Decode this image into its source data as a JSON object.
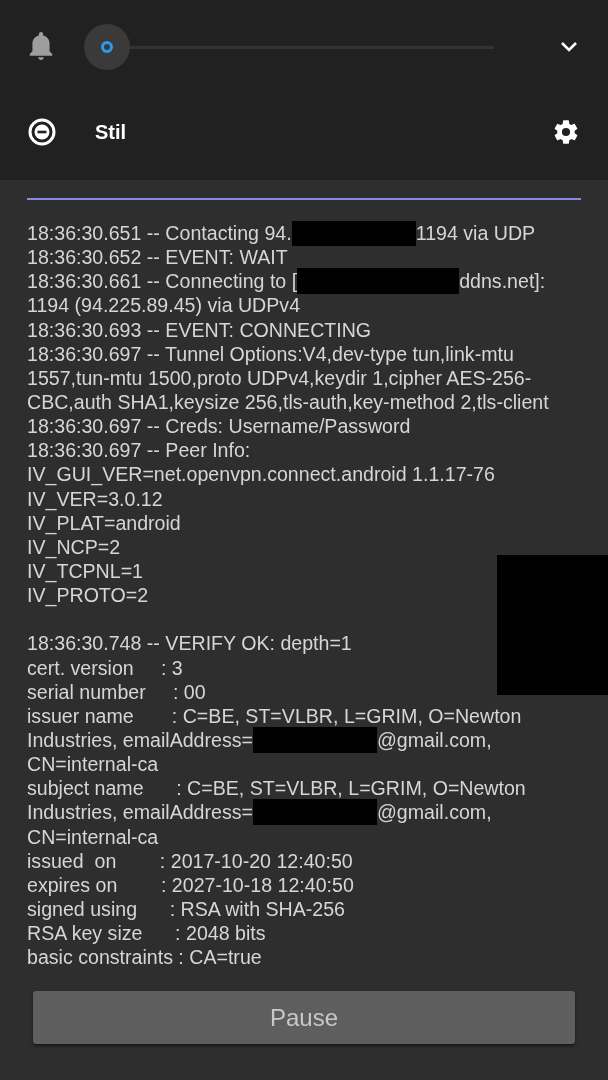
{
  "profile": {
    "label": "Stil"
  },
  "progress_line": {
    "level": 1
  },
  "log": [
    {
      "parts": [
        {
          "kind": "text",
          "text": "18:36:30.651 -- Contacting 94."
        },
        {
          "kind": "redaction"
        },
        {
          "kind": "text",
          "text": "1194 via UDP"
        }
      ]
    },
    {
      "parts": [
        {
          "kind": "text",
          "text": "18:36:30.652 -- EVENT: WAIT"
        }
      ]
    },
    {
      "parts": [
        {
          "kind": "text",
          "text": "18:36:30.661 -- Connecting to ["
        },
        {
          "kind": "wideredaction"
        },
        {
          "kind": "text",
          "text": "ddns.net]:"
        }
      ]
    },
    {
      "parts": [
        {
          "kind": "text",
          "text": "1194 (94.225.89.45) via UDPv4"
        }
      ]
    },
    {
      "parts": [
        {
          "kind": "text",
          "text": "18:36:30.693 -- EVENT: CONNECTING"
        }
      ]
    },
    {
      "parts": [
        {
          "kind": "text",
          "text": "18:36:30.697 -- Tunnel Options:V4,dev-type tun,link-mtu"
        }
      ]
    },
    {
      "parts": [
        {
          "kind": "text",
          "text": "1557,tun-mtu 1500,proto UDPv4,keydir 1,cipher AES-256-"
        }
      ]
    },
    {
      "parts": [
        {
          "kind": "text",
          "text": "CBC,auth SHA1,keysize 256,tls-auth,key-method 2,tls-client"
        }
      ]
    },
    {
      "parts": [
        {
          "kind": "text",
          "text": "18:36:30.697 -- Creds: Username/Password"
        }
      ]
    },
    {
      "parts": [
        {
          "kind": "text",
          "text": "18:36:30.697 -- Peer Info:"
        }
      ]
    },
    {
      "parts": [
        {
          "kind": "text",
          "text": "IV_GUI_VER=net.openvpn.connect.android 1.1.17-76"
        }
      ]
    },
    {
      "parts": [
        {
          "kind": "text",
          "text": "IV_VER=3.0.12"
        }
      ]
    },
    {
      "parts": [
        {
          "kind": "text",
          "text": "IV_PLAT=android"
        }
      ]
    },
    {
      "parts": [
        {
          "kind": "text",
          "text": "IV_NCP=2"
        }
      ]
    },
    {
      "parts": [
        {
          "kind": "text",
          "text": "IV_TCPNL=1"
        }
      ]
    },
    {
      "parts": [
        {
          "kind": "text",
          "text": "IV_PROTO=2"
        }
      ]
    },
    {
      "gap_before": true,
      "parts": [
        {
          "kind": "text",
          "text": "18:36:30.748 -- VERIFY OK: depth=1"
        }
      ]
    },
    {
      "parts": [
        {
          "kind": "text",
          "text": "cert. version     : 3"
        }
      ]
    },
    {
      "parts": [
        {
          "kind": "text",
          "text": "serial number     : 00"
        }
      ]
    },
    {
      "parts": [
        {
          "kind": "text",
          "text": "issuer name       : C=BE, ST=VLBR, L=GRIM, O=Newton"
        }
      ]
    },
    {
      "parts": [
        {
          "kind": "text",
          "text": "Industries, emailAddress="
        },
        {
          "kind": "redaction"
        },
        {
          "kind": "text",
          "text": "@gmail.com,"
        }
      ]
    },
    {
      "parts": [
        {
          "kind": "text",
          "text": "CN=internal-ca"
        }
      ]
    },
    {
      "parts": [
        {
          "kind": "text",
          "text": "subject name      : C=BE, ST=VLBR, L=GRIM, O=Newton"
        }
      ]
    },
    {
      "parts": [
        {
          "kind": "text",
          "text": "Industries, emailAddress="
        },
        {
          "kind": "redaction"
        },
        {
          "kind": "text",
          "text": "@gmail.com,"
        }
      ]
    },
    {
      "parts": [
        {
          "kind": "text",
          "text": "CN=internal-ca"
        }
      ]
    },
    {
      "parts": [
        {
          "kind": "text",
          "text": "issued  on        : 2017-10-20 12:40:50"
        }
      ]
    },
    {
      "parts": [
        {
          "kind": "text",
          "text": "expires on        : 2027-10-18 12:40:50"
        }
      ]
    },
    {
      "parts": [
        {
          "kind": "text",
          "text": "signed using      : RSA with SHA-256"
        }
      ]
    },
    {
      "parts": [
        {
          "kind": "text",
          "text": "RSA key size      : 2048 bits"
        }
      ]
    },
    {
      "parts": [
        {
          "kind": "text",
          "text": "basic constraints : CA=true"
        }
      ]
    }
  ],
  "corner_redaction": true,
  "pause_button": {
    "label": "Pause"
  }
}
